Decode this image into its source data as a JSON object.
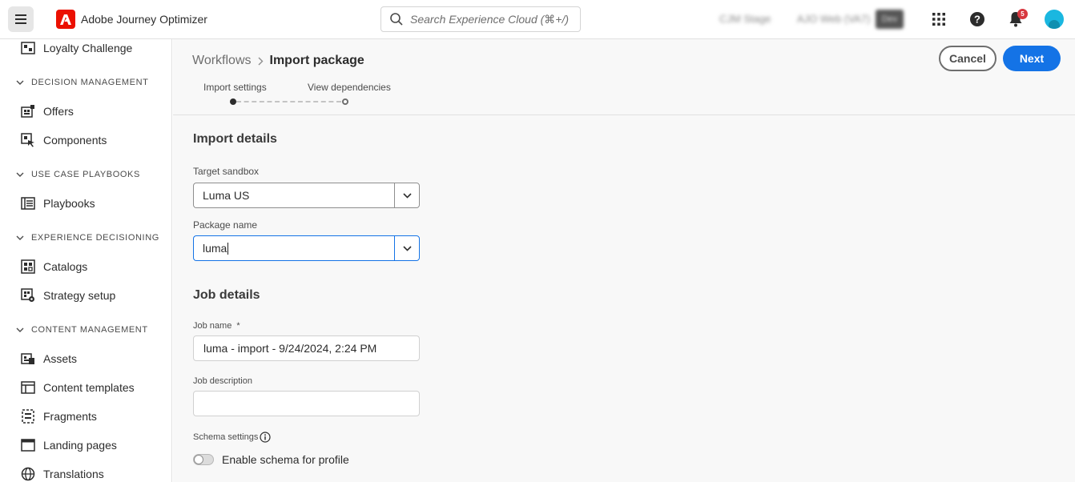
{
  "header": {
    "app_title": "Adobe Journey Optimizer",
    "search_placeholder": "Search Experience Cloud (⌘+/)",
    "org_name": "CJM Stage",
    "sandbox_name": "AJO Web (VA7)",
    "env_badge": "Dev",
    "notification_count": "5",
    "brand_color": "#eb1000",
    "avatar_color": "#1ab7e0"
  },
  "sidebar": {
    "items": [
      {
        "type": "item",
        "label": "Loyalty Challenge",
        "icon": "loyalty-icon"
      },
      {
        "type": "section",
        "label": "DECISION MANAGEMENT"
      },
      {
        "type": "item",
        "label": "Offers",
        "icon": "offers-icon"
      },
      {
        "type": "item",
        "label": "Components",
        "icon": "components-icon"
      },
      {
        "type": "section",
        "label": "USE CASE PLAYBOOKS"
      },
      {
        "type": "item",
        "label": "Playbooks",
        "icon": "playbooks-icon"
      },
      {
        "type": "section",
        "label": "EXPERIENCE DECISIONING"
      },
      {
        "type": "item",
        "label": "Catalogs",
        "icon": "catalogs-icon"
      },
      {
        "type": "item",
        "label": "Strategy setup",
        "icon": "strategy-icon"
      },
      {
        "type": "section",
        "label": "CONTENT MANAGEMENT"
      },
      {
        "type": "item",
        "label": "Assets",
        "icon": "assets-icon"
      },
      {
        "type": "item",
        "label": "Content templates",
        "icon": "templates-icon"
      },
      {
        "type": "item",
        "label": "Fragments",
        "icon": "fragments-icon"
      },
      {
        "type": "item",
        "label": "Landing pages",
        "icon": "landing-pages-icon"
      },
      {
        "type": "item",
        "label": "Translations",
        "icon": "globe-icon"
      }
    ]
  },
  "breadcrumb": {
    "root": "Workflows",
    "current": "Import package"
  },
  "actions": {
    "cancel_label": "Cancel",
    "next_label": "Next",
    "accent_color": "#1473e6"
  },
  "steps": [
    {
      "label": "Import settings",
      "state": "current"
    },
    {
      "label": "View dependencies",
      "state": "upcoming"
    }
  ],
  "form": {
    "import_details_title": "Import details",
    "target_sandbox_label": "Target sandbox",
    "target_sandbox_value": "Luma US",
    "package_name_label": "Package name",
    "package_name_value": "luma",
    "job_details_title": "Job details",
    "job_name_label": "Job name",
    "job_name_required": "*",
    "job_name_value": "luma - import - 9/24/2024, 2:24 PM",
    "job_description_label": "Job description",
    "job_description_value": "",
    "schema_settings_label": "Schema settings",
    "enable_schema_label": "Enable schema for profile",
    "enable_schema_on": false
  }
}
